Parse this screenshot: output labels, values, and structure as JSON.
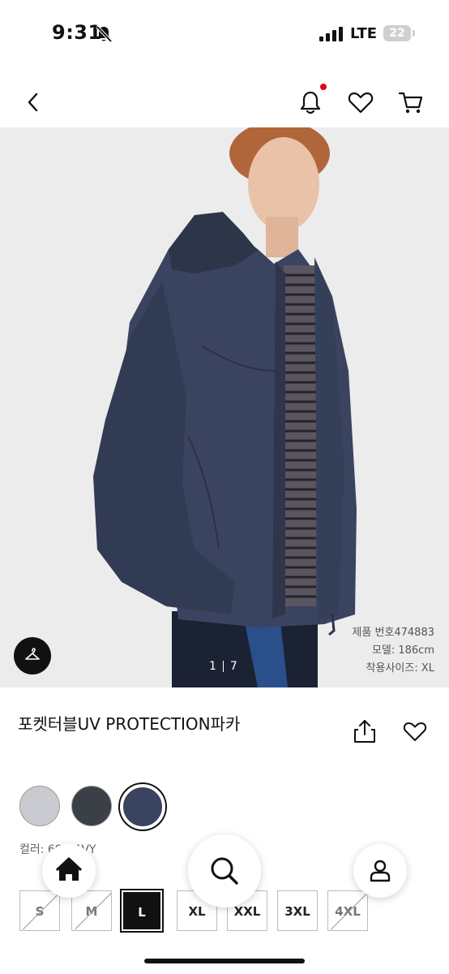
{
  "status_bar": {
    "time": "9:31",
    "network": "LTE",
    "battery": "22"
  },
  "header": {
    "back_icon": "chevron-left-icon",
    "notification_icon": "bell-icon",
    "wishlist_icon": "heart-icon",
    "cart_icon": "cart-icon",
    "accent": "#e60012"
  },
  "gallery": {
    "current": "1",
    "total": "7",
    "model_info": [
      "제품 번호474883",
      "모델: 186cm",
      "착용사이즈: XL"
    ]
  },
  "product": {
    "title": "포켓터블UV PROTECTION파카"
  },
  "colors": {
    "swatches": [
      {
        "hex": "#c9cbd1",
        "selected": false
      },
      {
        "hex": "#3b3f46",
        "selected": false
      },
      {
        "hex": "#3a4460",
        "selected": true
      }
    ],
    "label": "컬러: 69 NAVY"
  },
  "sizes": [
    {
      "label": "S",
      "available": false,
      "selected": false
    },
    {
      "label": "M",
      "available": false,
      "selected": false
    },
    {
      "label": "L",
      "available": true,
      "selected": true
    },
    {
      "label": "XL",
      "available": true,
      "selected": false
    },
    {
      "label": "XXL",
      "available": true,
      "selected": false
    },
    {
      "label": "3XL",
      "available": true,
      "selected": false
    },
    {
      "label": "4XL",
      "available": false,
      "selected": false
    }
  ],
  "bottom_nav": [
    "home-icon",
    "search-icon",
    "account-icon"
  ]
}
